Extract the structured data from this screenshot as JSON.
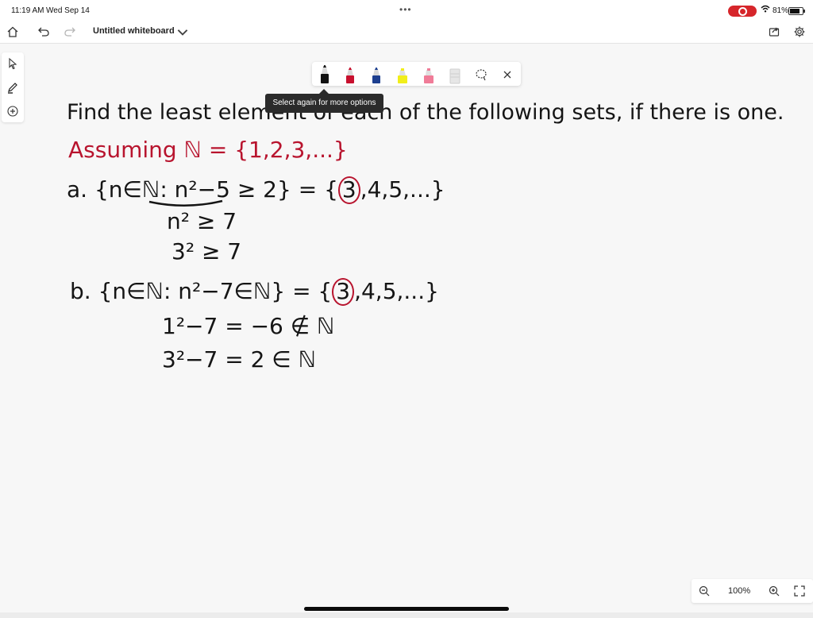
{
  "status_bar": {
    "time": "11:19 AM",
    "date": "Wed Sep 14",
    "battery": "81%"
  },
  "app_bar": {
    "title": "Untitled whiteboard"
  },
  "pen_tray": {
    "pens": [
      "black-pen",
      "red-pen",
      "blue-pen",
      "yellow-highlighter",
      "pink-highlighter",
      "eraser"
    ],
    "tooltip": "Select again for more options"
  },
  "whiteboard": {
    "heading": "Find the least element of each of the following sets, if there is one.",
    "assumption": "Assuming ℕ = {1,2,3,...}",
    "part_a": {
      "label": "a.",
      "set_expr": "{n∈ℕ: n²−5 ≥ 2} = {",
      "circled": "3",
      "set_rest": ",4,5,...}",
      "step1": "n² ≥ 7",
      "step2": "3² ≥ 7"
    },
    "part_b": {
      "label": "b.",
      "set_expr": "{n∈ℕ: n²−7∈ℕ} = {",
      "circled": "3",
      "set_rest": ",4,5,...}",
      "step1": "1²−7 = −6 ∉ ℕ",
      "step2": "3²−7 = 2 ∈ ℕ"
    }
  },
  "zoom": {
    "level": "100%"
  },
  "colors": {
    "ink_black": "#151515",
    "ink_red": "#b8142e",
    "record": "#d6262b"
  }
}
